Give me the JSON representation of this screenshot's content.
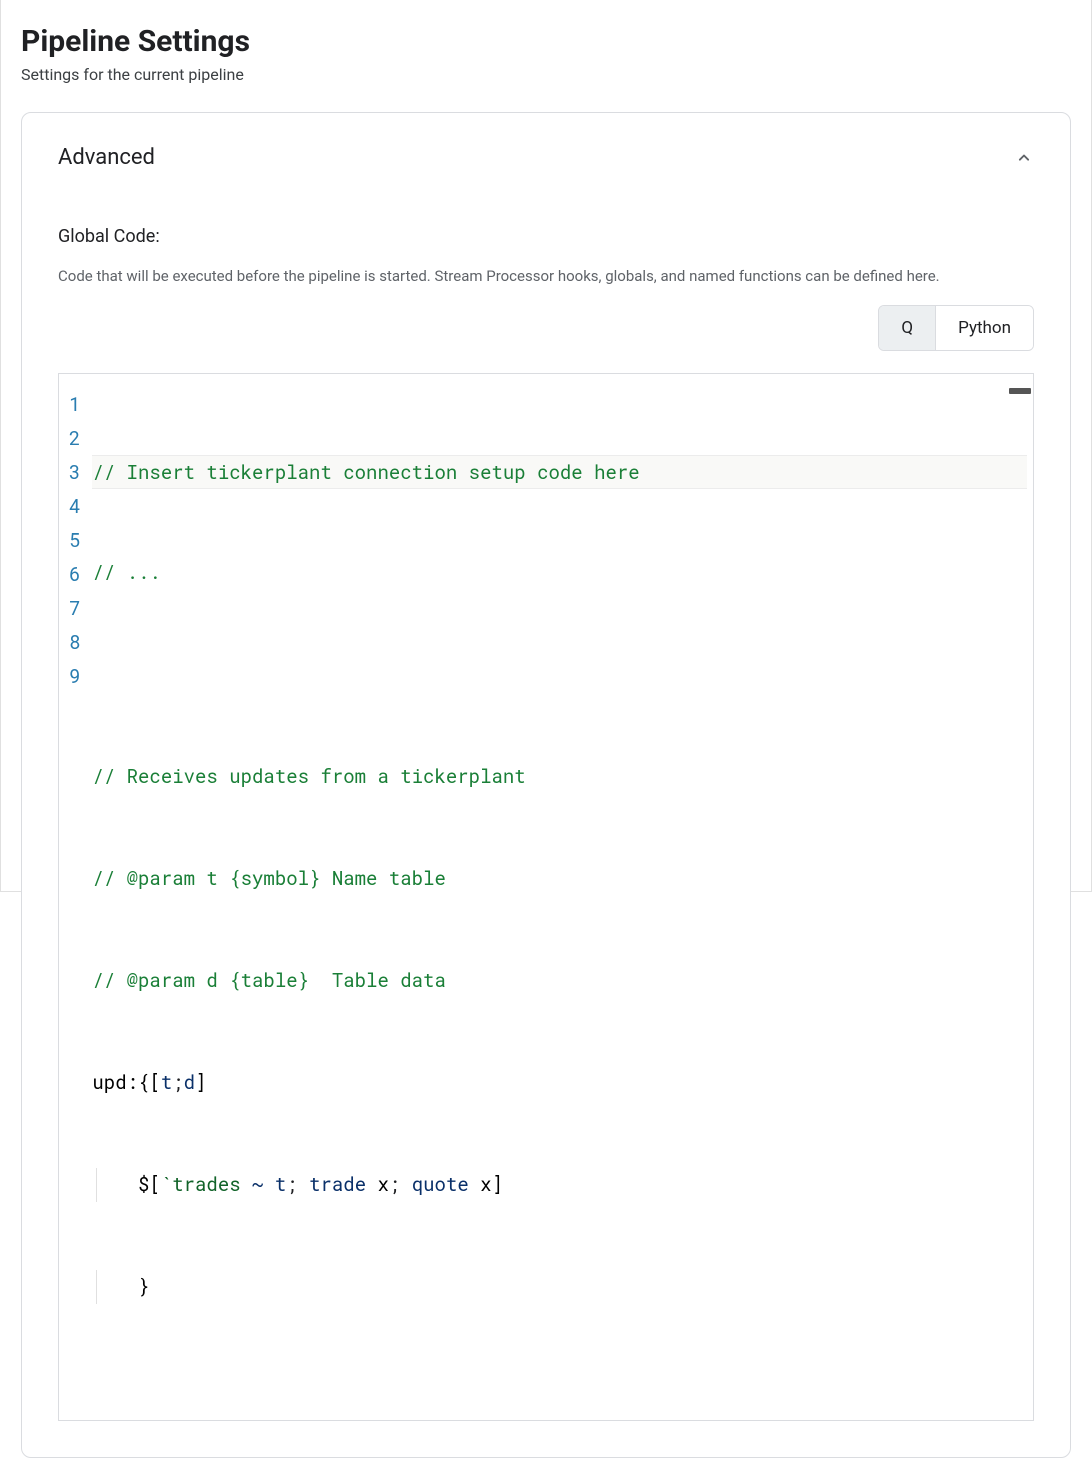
{
  "header": {
    "title": "Pipeline Settings",
    "subtitle": "Settings for the current pipeline"
  },
  "card": {
    "title": "Advanced",
    "collapsed": false
  },
  "globalCode": {
    "label": "Global Code:",
    "description": "Code that will be executed before the pipeline is started. Stream Processor hooks, globals, and named functions can be defined here."
  },
  "langToggle": {
    "options": [
      "Q",
      "Python"
    ],
    "active": "Q"
  },
  "editor": {
    "lineNumbers": [
      "1",
      "2",
      "3",
      "4",
      "5",
      "6",
      "7",
      "8",
      "9"
    ],
    "lines": {
      "l1": "// Insert tickerplant connection setup code here",
      "l2": "// ...",
      "l3": "",
      "l4": "// Receives updates from a tickerplant",
      "l5": "// @param t {symbol} Name table",
      "l6": "// @param d {table}  Table data",
      "l7_a": "upd:{[",
      "l7_b": "t",
      "l7_c": ";",
      "l7_d": "d",
      "l7_e": "]",
      "l8_a": "$[",
      "l8_b": "`trades",
      "l8_c": " ~ ",
      "l8_d": "t",
      "l8_e": "; ",
      "l8_f": "trade",
      "l8_g": " x",
      "l8_h": "; ",
      "l8_i": "quote",
      "l8_j": " x",
      "l8_k": "]",
      "l9": "}"
    }
  }
}
